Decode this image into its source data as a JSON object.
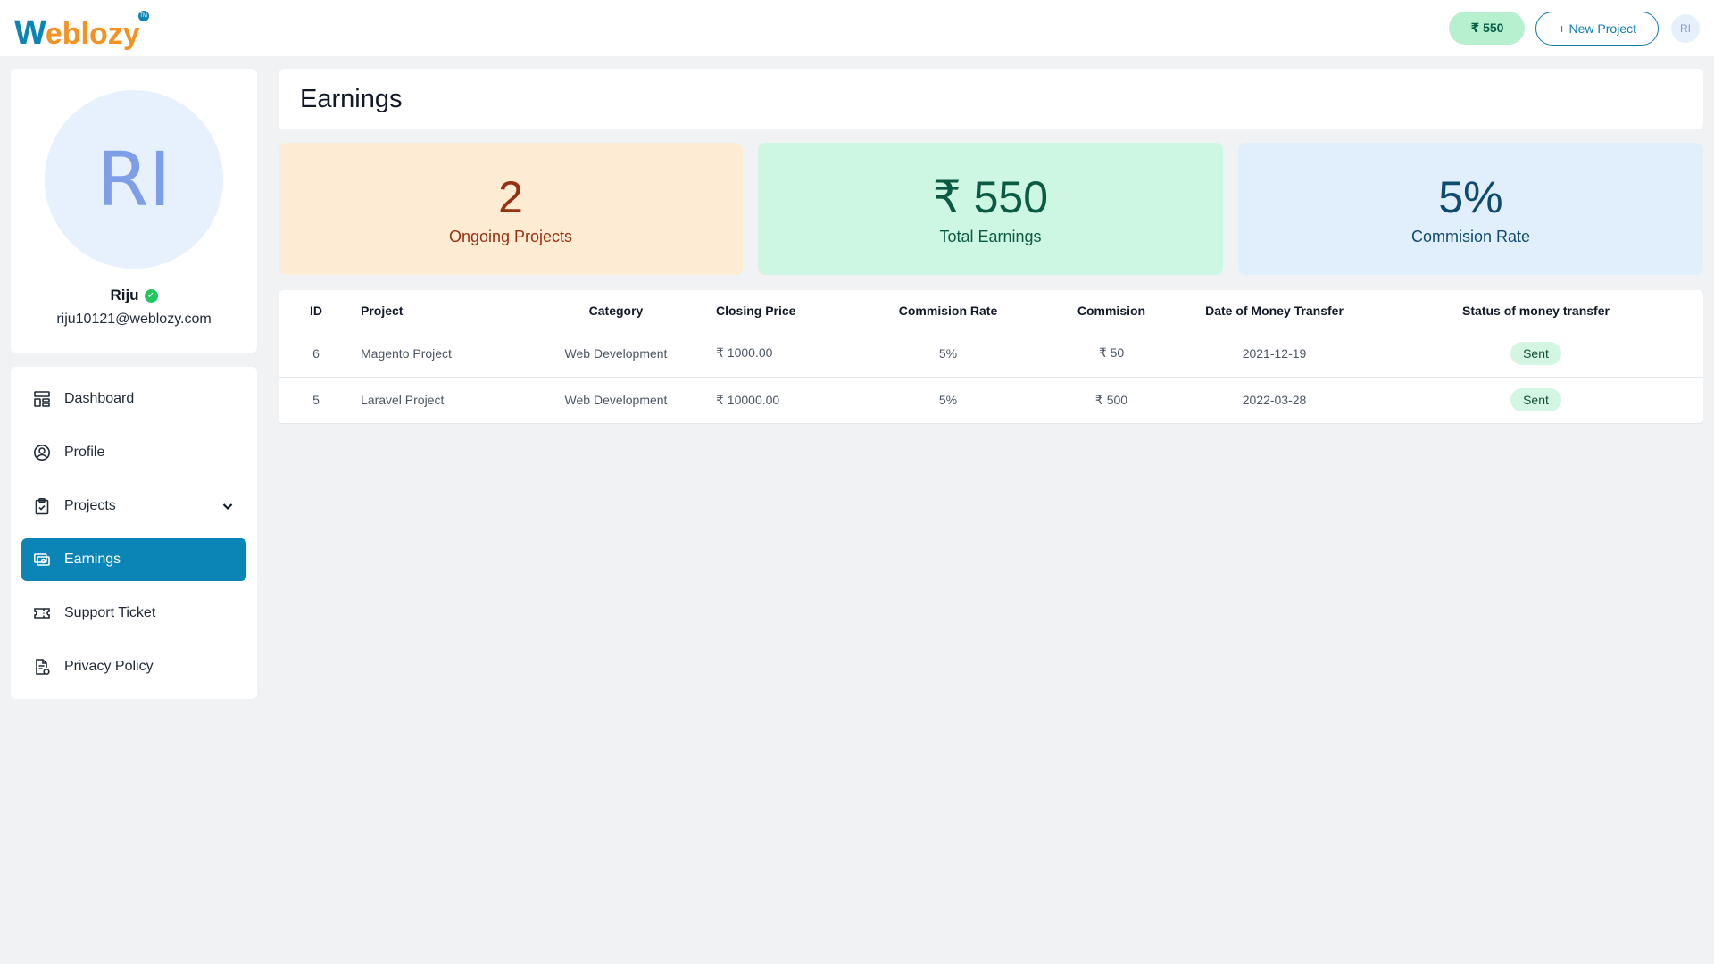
{
  "header": {
    "logo_first": "W",
    "logo_rest": "eblozy",
    "logo_tm": "TM",
    "balance": "₹ 550",
    "new_project": "+ New Project",
    "avatar_initials": "RI"
  },
  "profile": {
    "initials": "RI",
    "name": "Riju",
    "email": "riju10121@weblozy.com"
  },
  "sidebar": {
    "items": [
      {
        "label": "Dashboard",
        "icon": "dashboard-icon",
        "active": false
      },
      {
        "label": "Profile",
        "icon": "user-circle-icon",
        "active": false
      },
      {
        "label": "Projects",
        "icon": "clipboard-icon",
        "active": false,
        "has_dropdown": true
      },
      {
        "label": "Earnings",
        "icon": "cash-icon",
        "active": true
      },
      {
        "label": "Support Ticket",
        "icon": "ticket-icon",
        "active": false
      },
      {
        "label": "Privacy Policy",
        "icon": "document-shield-icon",
        "active": false
      }
    ]
  },
  "main": {
    "title": "Earnings",
    "stats": [
      {
        "value": "2",
        "label": "Ongoing Projects"
      },
      {
        "value": "₹ 550",
        "label": "Total Earnings"
      },
      {
        "value": "5%",
        "label": "Commision Rate"
      }
    ],
    "table": {
      "columns": [
        "ID",
        "Project",
        "Category",
        "Closing Price",
        "Commision Rate",
        "Commision",
        "Date of Money Transfer",
        "Status of money transfer"
      ],
      "rows": [
        {
          "id": "6",
          "project": "Magento Project",
          "category": "Web Development",
          "closing_price": "₹ 1000.00",
          "commision_rate": "5%",
          "commision": "₹ 50",
          "date": "2021-12-19",
          "status": "Sent"
        },
        {
          "id": "5",
          "project": "Laravel Project",
          "category": "Web Development",
          "closing_price": "₹ 10000.00",
          "commision_rate": "5%",
          "commision": "₹ 500",
          "date": "2022-03-28",
          "status": "Sent"
        }
      ]
    }
  },
  "colors": {
    "brand_blue": "#0b84b6",
    "brand_orange": "#f39222",
    "background": "#f1f2f4",
    "success": "#22c55e"
  }
}
